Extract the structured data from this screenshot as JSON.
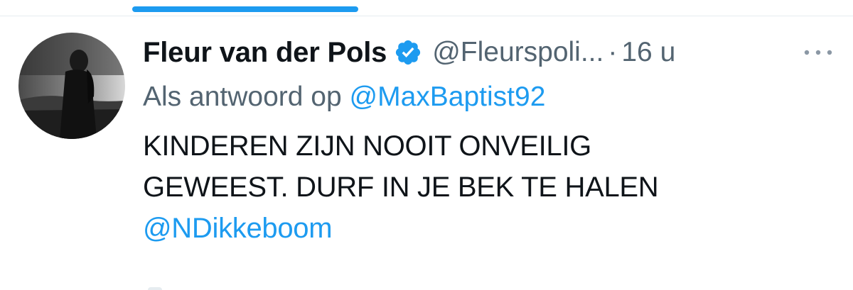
{
  "tabs": {
    "active_indicator_color": "#1d9bf0"
  },
  "tweet": {
    "author": {
      "display_name": "Fleur van der Pols",
      "handle": "@Fleurspoli...",
      "verified": true,
      "verified_icon": "verified-badge-icon",
      "avatar": "profile-photo"
    },
    "separator": "·",
    "timestamp": "16 u",
    "reply_prefix": "Als antwoord op",
    "reply_to": "@MaxBaptist92",
    "text_lines": [
      "KINDEREN ZIJN NOOIT ONVEILIG",
      "GEWEEST. DURF IN JE BEK TE HALEN"
    ],
    "text_mention": "@NDikkeboom",
    "more_icon": "more-options-icon"
  },
  "colors": {
    "accent": "#1d9bf0",
    "text_primary": "#0f1419",
    "text_secondary": "#536471"
  }
}
